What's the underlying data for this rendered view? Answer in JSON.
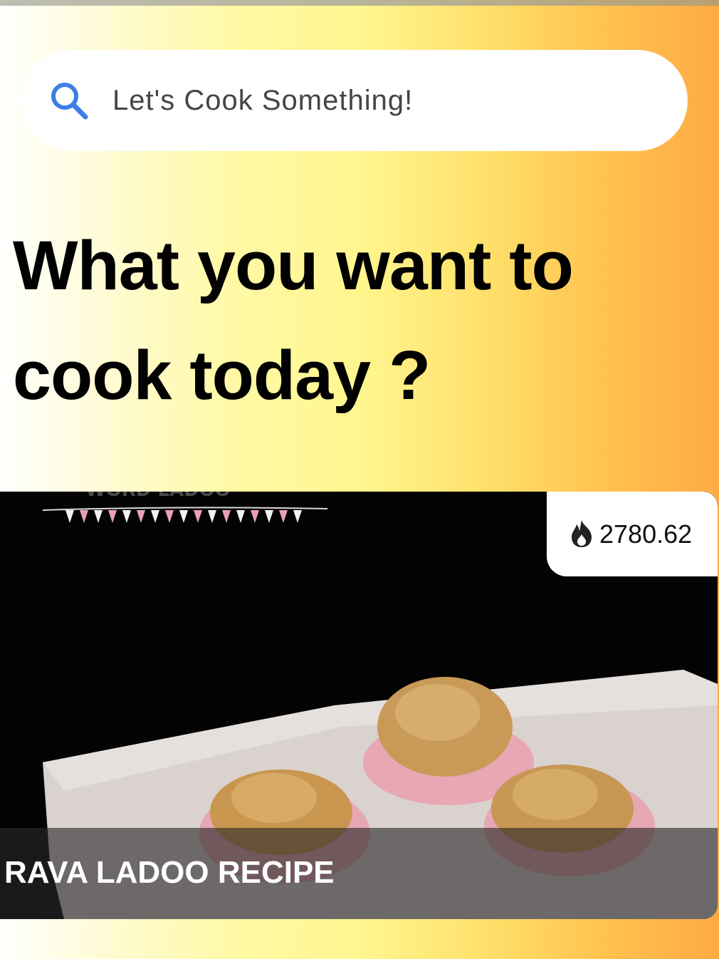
{
  "search": {
    "placeholder": "Let's Cook Something!",
    "icon": "search-icon"
  },
  "headline": "What you want to cook today ?",
  "recipe": {
    "title": "RAVA LADOO RECIPE",
    "rating": "2780.62",
    "rating_icon": "flame-icon"
  },
  "colors": {
    "search_icon": "#3d7ee8",
    "gradient_start": "#ffffff",
    "gradient_mid": "#fff68f",
    "gradient_end": "#fdaa45"
  }
}
